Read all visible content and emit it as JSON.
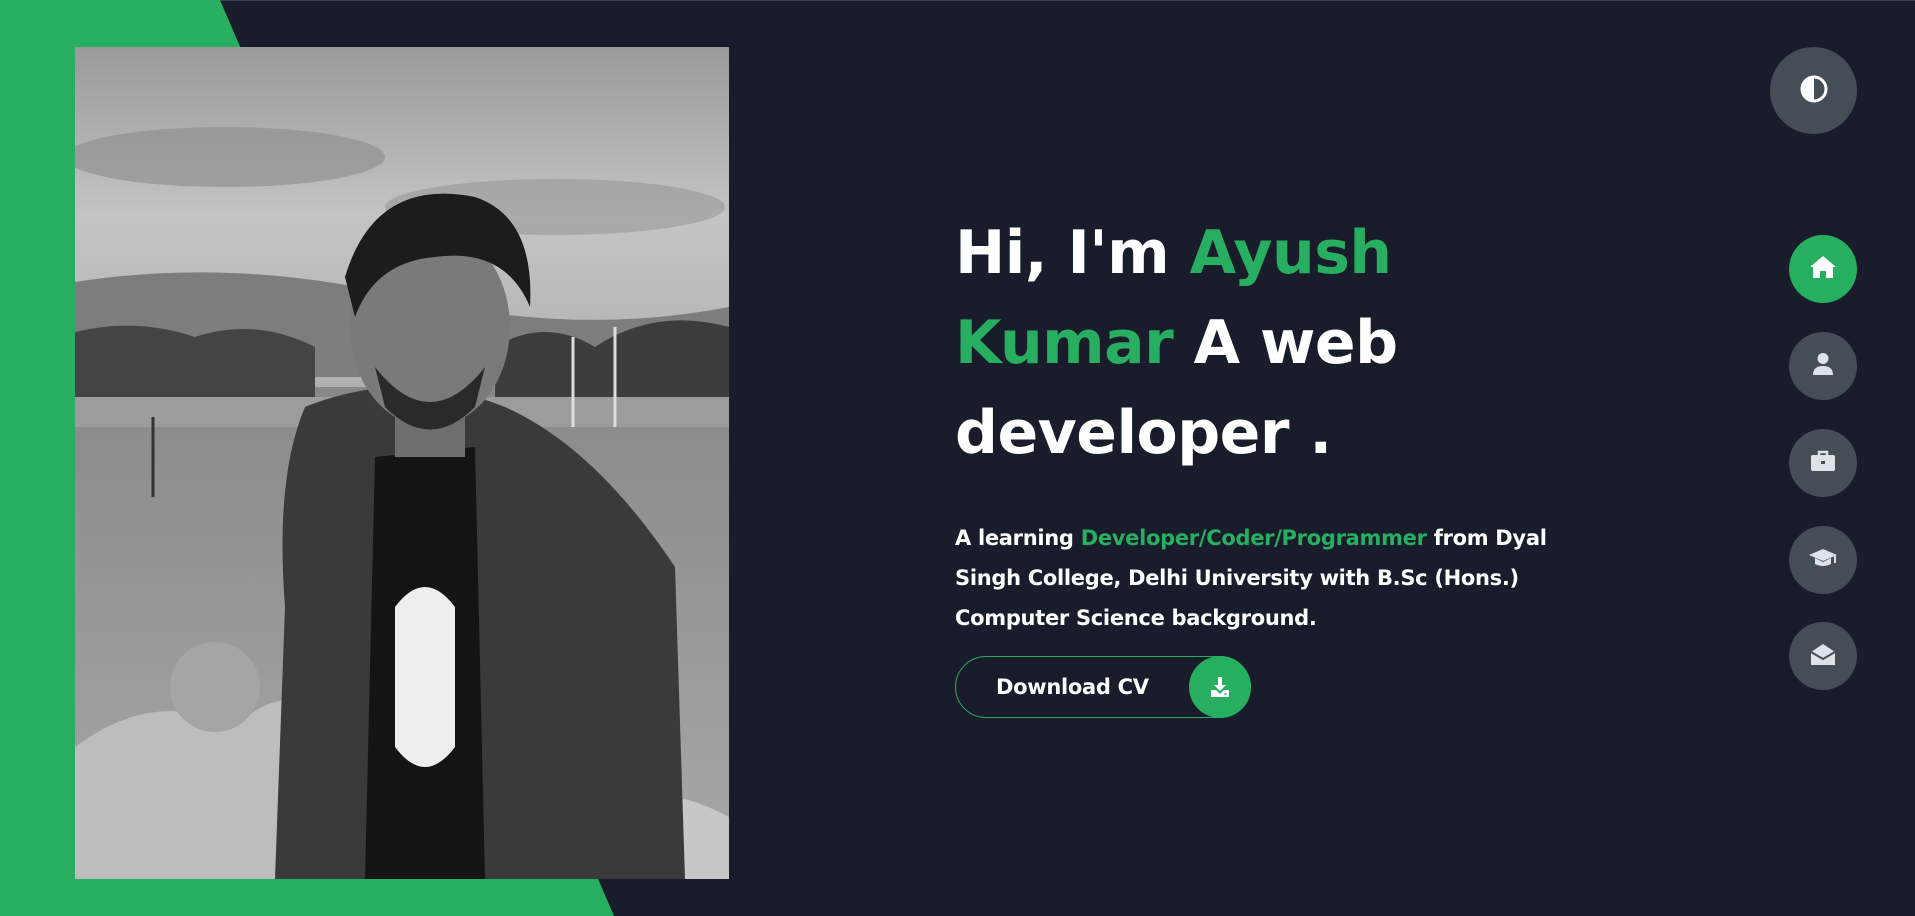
{
  "hero": {
    "greeting": "Hi, I'm",
    "first_name": "Ayush",
    "last_name": "Kumar",
    "role_line_1": "A web",
    "role_line_2": "developer ."
  },
  "description": {
    "prefix": "A learning",
    "highlight": "Developer/Coder/Programmer",
    "suffix": "from Dyal Singh College, Delhi University with B.Sc (Hons.) Computer Science background."
  },
  "cv_button": {
    "label": "Download CV",
    "icon": "download-icon"
  },
  "theme_toggle": {
    "icon": "contrast-icon"
  },
  "nav": [
    {
      "id": "home",
      "icon": "home-icon",
      "active": true
    },
    {
      "id": "about",
      "icon": "user-icon",
      "active": false
    },
    {
      "id": "portfolio",
      "icon": "briefcase-icon",
      "active": false
    },
    {
      "id": "education",
      "icon": "graduation-cap-icon",
      "active": false
    },
    {
      "id": "contact",
      "icon": "envelope-open-icon",
      "active": false
    }
  ],
  "colors": {
    "background": "#191d2b",
    "accent": "#27ae60",
    "button_bg": "#454e56",
    "text": "#ffffff"
  }
}
